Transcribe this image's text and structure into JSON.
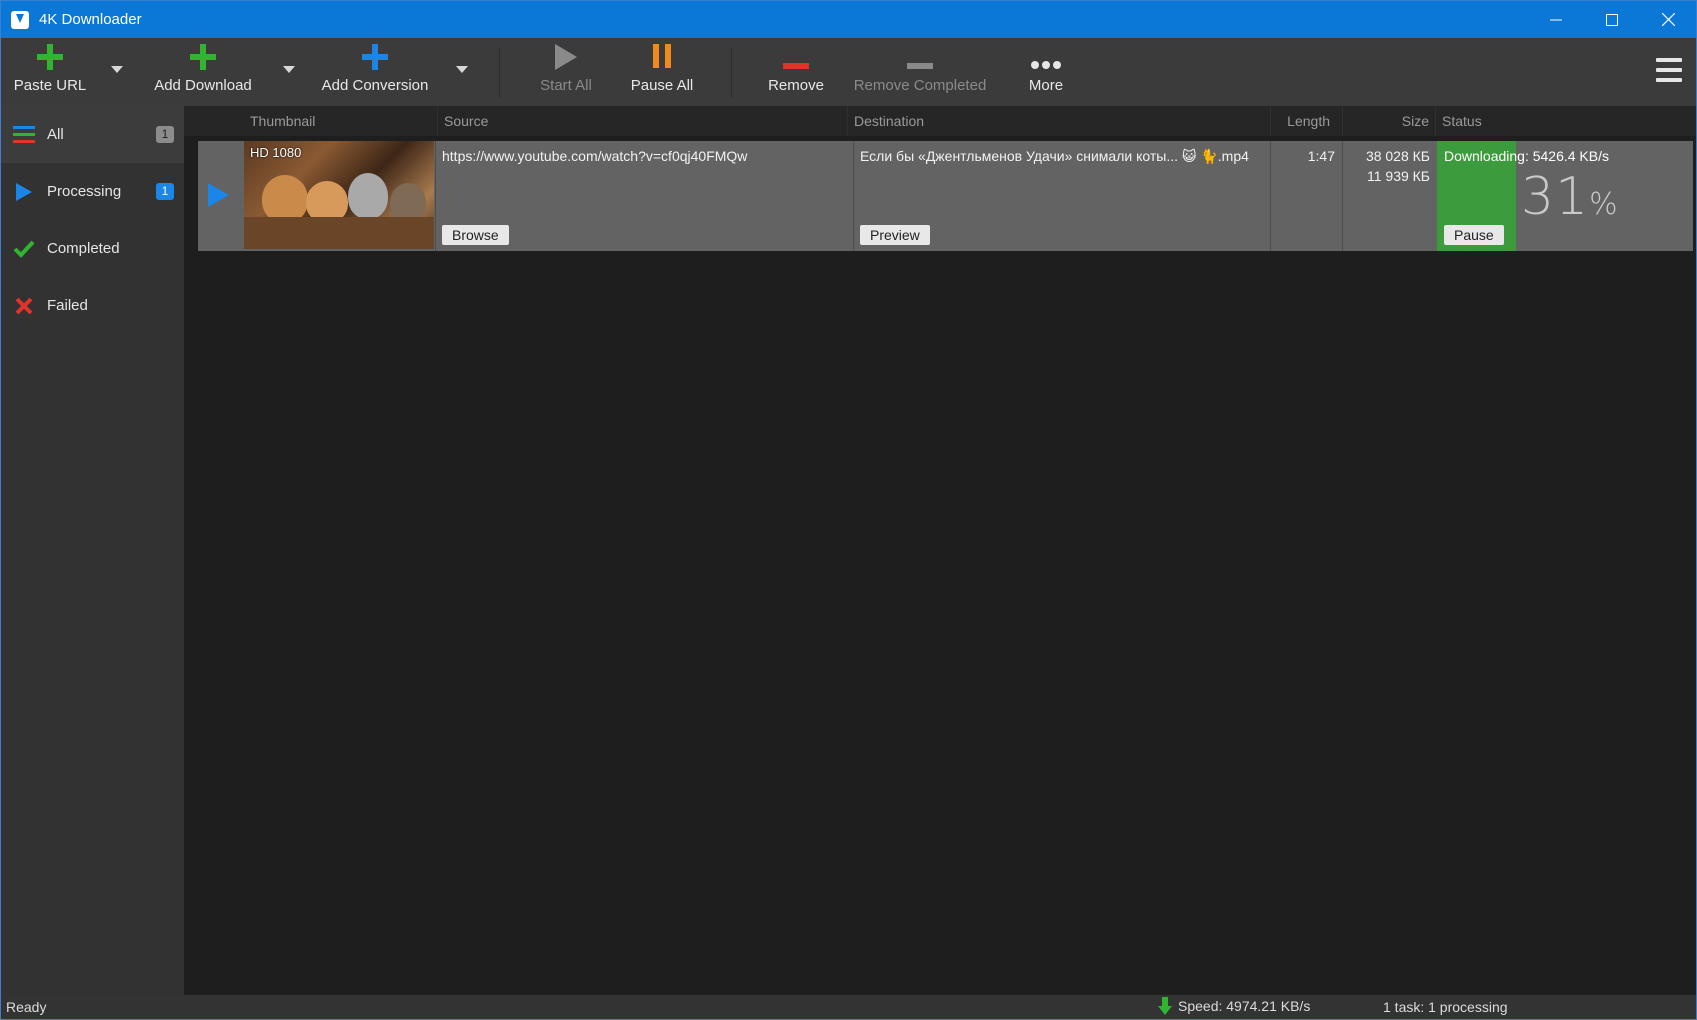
{
  "window": {
    "title": "4K Downloader"
  },
  "toolbar": {
    "paste_url": "Paste URL",
    "add_download": "Add Download",
    "add_conversion": "Add Conversion",
    "start_all": "Start All",
    "pause_all": "Pause All",
    "remove": "Remove",
    "remove_completed": "Remove Completed",
    "more": "More"
  },
  "sidebar": {
    "items": [
      {
        "label": "All",
        "count": "1",
        "icon": "list-icon"
      },
      {
        "label": "Processing",
        "count": "1",
        "icon": "play-icon"
      },
      {
        "label": "Completed",
        "icon": "checkmark-icon"
      },
      {
        "label": "Failed",
        "icon": "x-icon"
      }
    ]
  },
  "columns": {
    "thumbnail": "Thumbnail",
    "source": "Source",
    "destination": "Destination",
    "length": "Length",
    "size": "Size",
    "status": "Status"
  },
  "downloads": [
    {
      "quality": "HD 1080",
      "source": "https://www.youtube.com/watch?v=cf0qj40FMQw",
      "browse_label": "Browse",
      "destination": "Если бы «Джентльменов Удачи» снимали коты... 😺 🐈.mp4",
      "preview_label": "Preview",
      "length": "1:47",
      "size_total": "38 028 КБ",
      "size_done": "11 939 КБ",
      "status": "Downloading: 5426.4 KB/s",
      "progress_percent": "31",
      "percent_sign": "%",
      "progress_fraction": 0.31,
      "pause_label": "Pause"
    }
  ],
  "statusbar": {
    "state": "Ready",
    "speed": "Speed: 4974.21 KB/s",
    "tasks": "1 task: 1 processing"
  },
  "colors": {
    "titlebar": "#0b78d7",
    "accent_blue": "#1a86e8",
    "progress_green": "#3c9b3c",
    "add_green": "#2fb52f",
    "pause_orange": "#f08a1c",
    "remove_red": "#e0342a"
  }
}
